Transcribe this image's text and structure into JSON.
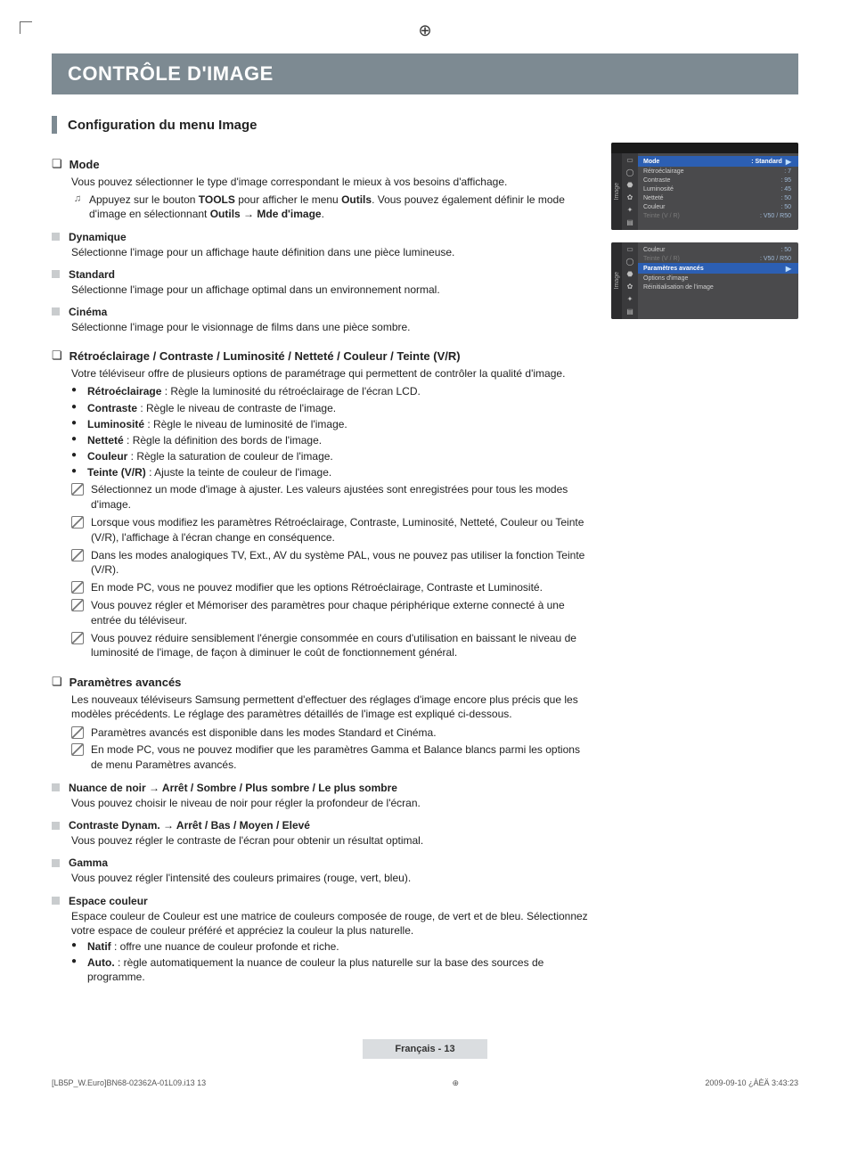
{
  "header": {
    "title": "CONTRÔLE D'IMAGE"
  },
  "section": {
    "heading": "Configuration du menu Image"
  },
  "mode": {
    "title": "Mode",
    "intro": "Vous pouvez sélectionner le type d'image correspondant le mieux à vos besoins d'affichage.",
    "tools_prefix": "Appuyez sur le bouton ",
    "tools_b1": "TOOLS",
    "tools_mid1": " pour afficher le menu ",
    "tools_b2": "Outils",
    "tools_mid2": ". Vous pouvez également définir le mode d'image en sélectionnant ",
    "tools_b3": "Outils → Mde d'image",
    "tools_end": ".",
    "items": [
      {
        "name": "Dynamique",
        "desc": "Sélectionne l'image pour un affichage haute définition dans une pièce lumineuse."
      },
      {
        "name": "Standard",
        "desc": "Sélectionne l'image pour un affichage optimal dans un environnement normal."
      },
      {
        "name": "Cinéma",
        "desc": "Sélectionne l'image pour le visionnage de films dans une pièce sombre."
      }
    ]
  },
  "retro": {
    "title": "Rétroéclairage / Contraste / Luminosité / Netteté / Couleur / Teinte (V/R)",
    "intro": "Votre téléviseur offre de plusieurs options de paramétrage qui permettent de contrôler la qualité d'image.",
    "bullets": [
      {
        "b": "Rétroéclairage",
        "t": " : Règle la luminosité du rétroéclairage de l'écran LCD."
      },
      {
        "b": "Contraste",
        "t": " : Règle le niveau de contraste de l'image."
      },
      {
        "b": "Luminosité",
        "t": " : Règle le niveau de luminosité de l'image."
      },
      {
        "b": "Netteté",
        "t": " : Règle la définition des bords de l'image."
      },
      {
        "b": "Couleur",
        "t": " : Règle la saturation de couleur de l'image."
      },
      {
        "b": "Teinte (V/R)",
        "t": " : Ajuste la teinte de couleur de l'image."
      }
    ],
    "notes": [
      "Sélectionnez un mode d'image à ajuster. Les valeurs ajustées sont enregistrées pour tous les modes d'image.",
      "Lorsque vous modifiez les paramètres Rétroéclairage, Contraste, Luminosité, Netteté, Couleur ou Teinte (V/R), l'affichage à l'écran change en conséquence.",
      "Dans les modes analogiques TV, Ext., AV du système PAL, vous ne pouvez pas utiliser la fonction Teinte (V/R).",
      "En mode PC, vous ne pouvez modifier que les options Rétroéclairage, Contraste et Luminosité.",
      "Vous pouvez régler et Mémoriser des paramètres pour chaque périphérique externe connecté à une entrée du téléviseur.",
      "Vous pouvez réduire sensiblement l'énergie consommée en cours d'utilisation en baissant le niveau de luminosité de l'image, de façon à diminuer le coût de fonctionnement général."
    ]
  },
  "advanced": {
    "title": "Paramètres avancés",
    "intro": "Les nouveaux téléviseurs Samsung permettent d'effectuer des réglages d'image encore plus précis que les modèles précédents. Le réglage des paramètres détaillés de l'image est expliqué ci-dessous.",
    "notes": [
      "Paramètres avancés est disponible dans les modes Standard et Cinéma.",
      "En mode PC, vous ne pouvez modifier que les paramètres Gamma et Balance blancs parmi les options de menu Paramètres avancés."
    ],
    "subs": [
      {
        "name": "Nuance de noir → Arrêt / Sombre / Plus sombre / Le plus sombre",
        "desc": "Vous pouvez choisir le niveau de noir pour régler la profondeur de l'écran."
      },
      {
        "name": "Contraste Dynam. → Arrêt / Bas / Moyen / Elevé",
        "desc": "Vous pouvez régler le contraste de l'écran pour obtenir un résultat optimal."
      },
      {
        "name": "Gamma",
        "desc": "Vous pouvez régler l'intensité des couleurs primaires (rouge, vert, bleu)."
      },
      {
        "name": "Espace couleur",
        "desc": "Espace couleur de Couleur est une matrice de couleurs composée de rouge, de vert et de bleu. Sélectionnez votre espace de couleur préféré et appréciez la couleur la plus naturelle."
      }
    ],
    "espace_bullets": [
      {
        "b": "Natif",
        "t": " : offre une nuance de couleur profonde et riche."
      },
      {
        "b": "Auto.",
        "t": " : règle automatiquement la nuance de couleur la plus naturelle sur la base des sources de programme."
      }
    ]
  },
  "osd1": {
    "side": "Image",
    "rows": [
      {
        "lbl": "Mode",
        "val": ": Standard",
        "hl": true,
        "arrow": "▶"
      },
      {
        "lbl": "Rétroéclairage",
        "val": ": 7"
      },
      {
        "lbl": "Contraste",
        "val": ": 95"
      },
      {
        "lbl": "Luminosité",
        "val": ": 45"
      },
      {
        "lbl": "Netteté",
        "val": ": 50"
      },
      {
        "lbl": "Couleur",
        "val": ": 50"
      },
      {
        "lbl": "Teinte (V / R)",
        "val": ": V50 / R50",
        "dim": true
      }
    ]
  },
  "osd2": {
    "side": "Image",
    "rows_top": [
      {
        "lbl": "Couleur",
        "val": ": 50"
      },
      {
        "lbl": "Teinte (V / R)",
        "val": ": V50 / R50",
        "dim": true
      }
    ],
    "hl": {
      "lbl": "Paramètres avancés",
      "arrow": "▶"
    },
    "rows_bottom": [
      {
        "lbl": "Options d'image"
      },
      {
        "lbl": "Réinitialisation de l'image"
      }
    ]
  },
  "footer": {
    "page": "Français - 13",
    "left": "[LB5P_W.Euro]BN68-02362A-01L09.i13   13",
    "right": "2009-09-10   ¿ÀÈÄ 3:43:23"
  }
}
